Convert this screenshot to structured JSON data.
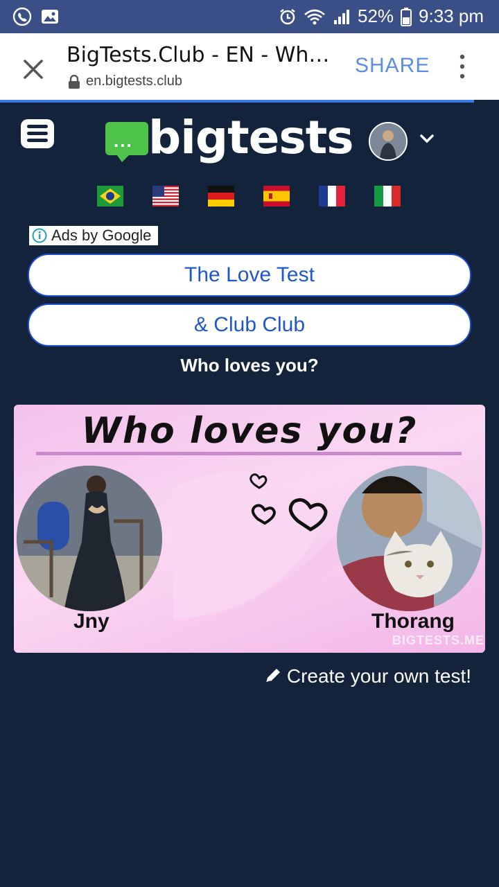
{
  "status_bar": {
    "battery": "52%",
    "time": "9:33 pm"
  },
  "browser": {
    "tab_title": "BigTests.Club - EN - Who l...",
    "url": "en.bigtests.club",
    "share_label": "SHARE"
  },
  "header": {
    "logo_text": "bigtests",
    "logo_dots": "...",
    "flags": [
      "brazil",
      "usa",
      "germany",
      "spain",
      "france",
      "italy"
    ]
  },
  "ads": {
    "label": "Ads by Google"
  },
  "buttons": {
    "love_test": "The Love Test",
    "club_club": "& Club Club"
  },
  "question": "Who loves you?",
  "card": {
    "title": "Who loves you?",
    "left_name": "Jny",
    "right_name": "Thorang",
    "watermark": "BIGTESTS.ME"
  },
  "create_link": "Create your own test!",
  "colors": {
    "background": "#13233b",
    "status_bar": "#3a4f86",
    "accent_blue": "#2057c8",
    "logo_green": "#4ec34a",
    "card_pink": "#f9cdef"
  }
}
